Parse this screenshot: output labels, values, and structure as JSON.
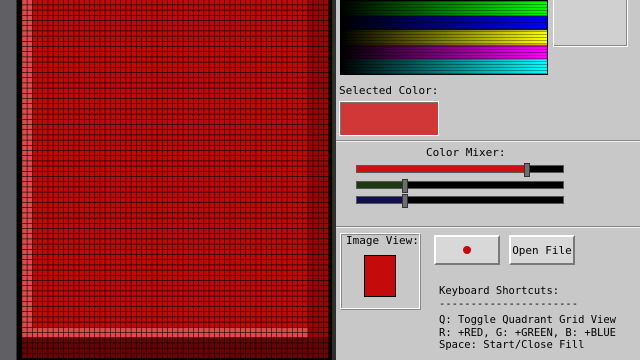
{
  "palette": {
    "rows": [
      [
        "#000000",
        "#00ff00"
      ],
      [
        "#000000",
        "#0000ff"
      ],
      [
        "#000000",
        "#ffff00"
      ],
      [
        "#000000",
        "#ff00ff"
      ],
      [
        "#000000",
        "#00ffff"
      ]
    ]
  },
  "selected_color": {
    "label": "Selected Color:",
    "value": "#d23737"
  },
  "mixer": {
    "title": "Color Mixer:",
    "channels": [
      {
        "name": "red",
        "color": "#d01010",
        "level": 0.82
      },
      {
        "name": "green",
        "color": "#1a3a10",
        "level": 0.23
      },
      {
        "name": "blue",
        "color": "#101050",
        "level": 0.23
      }
    ]
  },
  "image_view": {
    "label": "Image View:",
    "thumb_color": "#c40a0a"
  },
  "buttons": {
    "fill_dot_color": "#c40a0a",
    "open_file": "Open File"
  },
  "shortcuts": {
    "title": "Keyboard Shortcuts:",
    "divider": "----------------------",
    "lines": [
      "Q: Toggle Quadrant Grid View",
      "R: +RED, G: +GREEN, B: +BLUE",
      "Space: Start/Close Fill"
    ]
  },
  "canvas": {
    "fill_color": "#c20808",
    "highlight_color": "#e04a4a",
    "shade_color": "#9a0606",
    "dark_color": "#6a0404",
    "grid_color": "#1a0000"
  }
}
